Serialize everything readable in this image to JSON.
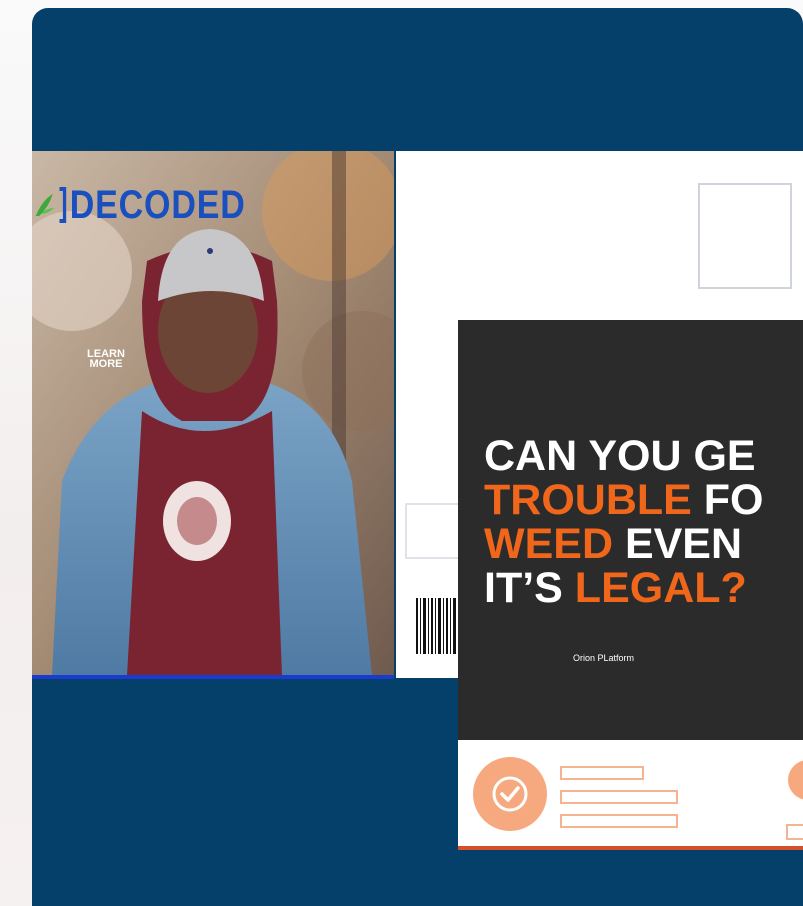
{
  "brand": {
    "logo_text": "DECODED",
    "logo_color": "#1a4fbf"
  },
  "hero": {
    "learn_more": "LEARN MORE"
  },
  "headline": {
    "line1": "CAN YOU GE",
    "line2_orange": "TROUBLE",
    "line2_white": " FO",
    "line3_orange": "WEED",
    "line3_white": " EVEN",
    "line4_white": "IT’S ",
    "line4_orange": "LEGAL?",
    "caption": "Orion PLatform"
  },
  "colors": {
    "card_background": "#05406a",
    "accent_orange": "#f0661a",
    "dark_panel": "#2b2b2b"
  },
  "icons": {
    "status_icon": "check-circle-icon",
    "logo_leaf": "cannabis-leaf-icon"
  }
}
